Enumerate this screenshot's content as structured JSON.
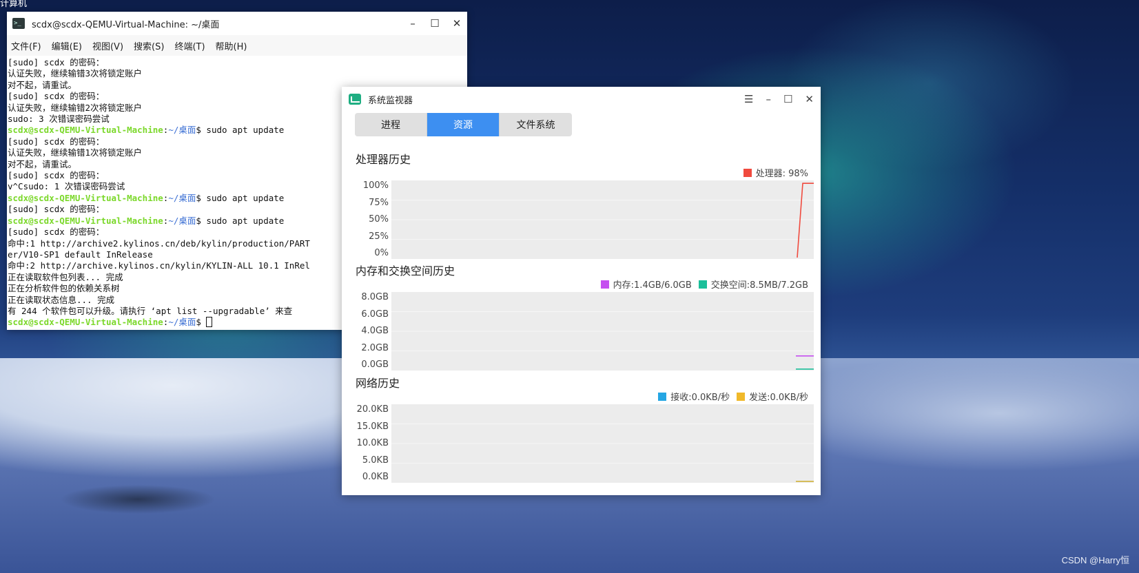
{
  "desktop": {
    "corner_label": "计算机",
    "watermark": "CSDN @Harry恒"
  },
  "terminal": {
    "title": "scdx@scdx-QEMU-Virtual-Machine: ~/桌面",
    "menu": [
      "文件(F)",
      "编辑(E)",
      "视图(V)",
      "搜索(S)",
      "终端(T)",
      "帮助(H)"
    ],
    "lines": [
      {
        "text": "[sudo] scdx 的密码："
      },
      {
        "text": "认证失败，继续输错3次将锁定账户"
      },
      {
        "text": "对不起，请重试。"
      },
      {
        "text": "[sudo] scdx 的密码："
      },
      {
        "text": "认证失败，继续输错2次将锁定账户"
      },
      {
        "text": "sudo: 3 次错误密码尝试"
      },
      {
        "user": "scdx@scdx-QEMU-Virtual-Machine",
        "path": "~/桌面",
        "cmd": "$ sudo apt update"
      },
      {
        "text": "[sudo] scdx 的密码："
      },
      {
        "text": "认证失败，继续输错1次将锁定账户"
      },
      {
        "text": "对不起，请重试。"
      },
      {
        "text": "[sudo] scdx 的密码："
      },
      {
        "text": "v^Csudo: 1 次错误密码尝试"
      },
      {
        "user": "scdx@scdx-QEMU-Virtual-Machine",
        "path": "~/桌面",
        "cmd": "$ sudo apt update"
      },
      {
        "text": "[sudo] scdx 的密码："
      },
      {
        "user": "scdx@scdx-QEMU-Virtual-Machine",
        "path": "~/桌面",
        "cmd": "$ sudo apt update"
      },
      {
        "text": "[sudo] scdx 的密码："
      },
      {
        "text": "命中:1 http://archive2.kylinos.cn/deb/kylin/production/PART"
      },
      {
        "text": "er/V10-SP1 default InRelease"
      },
      {
        "text": "命中:2 http://archive.kylinos.cn/kylin/KYLIN-ALL 10.1 InRel"
      },
      {
        "text": "正在读取软件包列表... 完成"
      },
      {
        "text": "正在分析软件包的依赖关系树"
      },
      {
        "text": "正在读取状态信息... 完成"
      },
      {
        "text": "有 244 个软件包可以升级。请执行 ‘apt list --upgradable’ 来查"
      },
      {
        "user": "scdx@scdx-QEMU-Virtual-Machine",
        "path": "~/桌面",
        "cmd": "$ ",
        "cursor": true
      }
    ]
  },
  "monitor": {
    "title": "系统监视器",
    "tabs": [
      {
        "label": "进程",
        "active": false
      },
      {
        "label": "资源",
        "active": true
      },
      {
        "label": "文件系统",
        "active": false
      }
    ],
    "cpu": {
      "title": "处理器历史",
      "legend": [
        {
          "label": "处理器: 98%",
          "color": "#f04a3e"
        }
      ],
      "ticks": [
        "100%",
        "75%",
        "50%",
        "25%",
        "0%"
      ]
    },
    "memory": {
      "title": "内存和交换空间历史",
      "legend": [
        {
          "label": "内存:1.4GB/6.0GB",
          "color": "#c54ff0"
        },
        {
          "label": "交换空间:8.5MB/7.2GB",
          "color": "#1bbf9a"
        }
      ],
      "ticks": [
        "8.0GB",
        "6.0GB",
        "4.0GB",
        "2.0GB",
        "0.0GB"
      ]
    },
    "network": {
      "title": "网络历史",
      "legend": [
        {
          "label": "接收:0.0KB/秒",
          "color": "#25a6e3"
        },
        {
          "label": "发送:0.0KB/秒",
          "color": "#f0b92a"
        }
      ],
      "ticks": [
        "20.0KB",
        "15.0KB",
        "10.0KB",
        "5.0KB",
        "0.0KB"
      ]
    }
  },
  "chart_data": [
    {
      "type": "line",
      "title": "处理器历史",
      "ylim": [
        0,
        100
      ],
      "series": [
        {
          "name": "处理器",
          "color": "#f04a3e",
          "values": [
            0,
            98,
            98,
            98
          ]
        }
      ]
    },
    {
      "type": "line",
      "title": "内存和交换空间历史",
      "ylim": [
        0,
        8
      ],
      "series": [
        {
          "name": "内存",
          "color": "#c54ff0",
          "values": [
            1.4,
            1.4,
            1.4
          ]
        },
        {
          "name": "交换空间",
          "color": "#1bbf9a",
          "values": [
            0.0085,
            0.0085,
            0.0085
          ]
        }
      ]
    },
    {
      "type": "line",
      "title": "网络历史",
      "ylim": [
        0,
        20
      ],
      "series": [
        {
          "name": "接收",
          "color": "#25a6e3",
          "values": [
            0,
            0,
            0
          ]
        },
        {
          "name": "发送",
          "color": "#f0b92a",
          "values": [
            0,
            0,
            0
          ]
        }
      ]
    }
  ]
}
